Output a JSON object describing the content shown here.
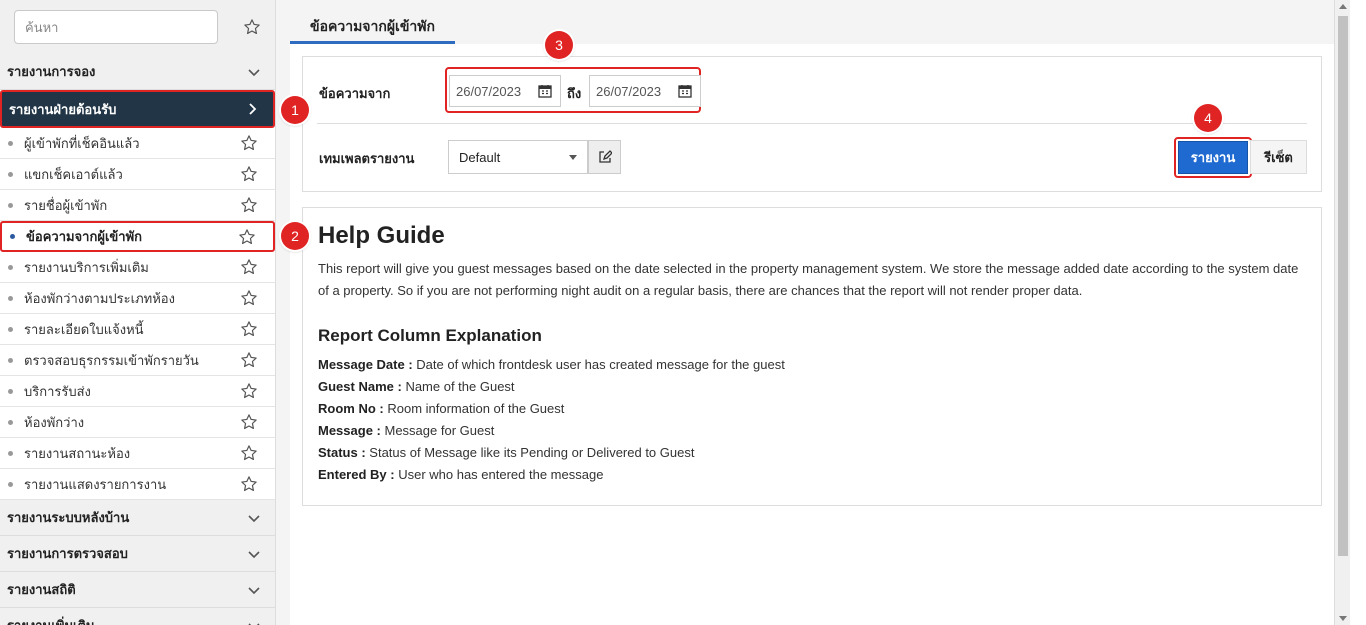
{
  "sidebar": {
    "search_placeholder": "ค้นหา",
    "groups_top": [
      {
        "label": "รายงานการจอง"
      }
    ],
    "active_group": {
      "label": "รายงานฝ่ายต้อนรับ"
    },
    "items": [
      {
        "label": "ผู้เข้าพักที่เช็คอินแล้ว"
      },
      {
        "label": "แขกเช็คเอาต์แล้ว"
      },
      {
        "label": "รายชื่อผู้เข้าพัก"
      },
      {
        "label": "ข้อความจากผู้เข้าพัก"
      },
      {
        "label": "รายงานบริการเพิ่มเติม"
      },
      {
        "label": "ห้องพักว่างตามประเภทห้อง"
      },
      {
        "label": "รายละเอียดใบแจ้งหนี้"
      },
      {
        "label": "ตรวจสอบธุรกรรมเข้าพักรายวัน"
      },
      {
        "label": "บริการรับส่ง"
      },
      {
        "label": "ห้องพักว่าง"
      },
      {
        "label": "รายงานสถานะห้อง"
      },
      {
        "label": "รายงานแสดงรายการงาน"
      }
    ],
    "groups_bottom": [
      {
        "label": "รายงานระบบหลังบ้าน"
      },
      {
        "label": "รายงานการตรวจสอบ"
      },
      {
        "label": "รายงานสถิติ"
      },
      {
        "label": "รายงานเพิ่มเติม"
      }
    ]
  },
  "main": {
    "tab_label": "ข้อความจากผู้เข้าพัก",
    "filter": {
      "from_label": "ข้อความจาก",
      "date_from": "26/07/2023",
      "to_label": "ถึง",
      "date_to": "26/07/2023",
      "template_label": "เทมเพลตรายงาน",
      "template_value": "Default",
      "report_button": "รายงาน",
      "reset_button": "รีเซ็ต"
    },
    "help": {
      "title": "Help Guide",
      "description": "This report will give you guest messages based on the date selected in the property management system. We store the message added date according to the system date of a property. So if you are not performing night audit on a regular basis, there are chances that the report will not render proper data.",
      "columns_title": "Report Column Explanation",
      "columns": [
        {
          "name": "Message Date :",
          "desc": "Date of which frontdesk user has created message for the guest"
        },
        {
          "name": "Guest Name :",
          "desc": "Name of the Guest"
        },
        {
          "name": "Room No :",
          "desc": "Room information of the Guest"
        },
        {
          "name": "Message :",
          "desc": "Message for Guest"
        },
        {
          "name": "Status :",
          "desc": "Status of Message like its Pending or Delivered to Guest"
        },
        {
          "name": "Entered By :",
          "desc": "User who has entered the message"
        }
      ]
    }
  },
  "callouts": [
    "1",
    "2",
    "3",
    "4"
  ],
  "colors": {
    "accent": "#1e6ad1",
    "active_bg": "#213547",
    "highlight": "#e02424"
  }
}
